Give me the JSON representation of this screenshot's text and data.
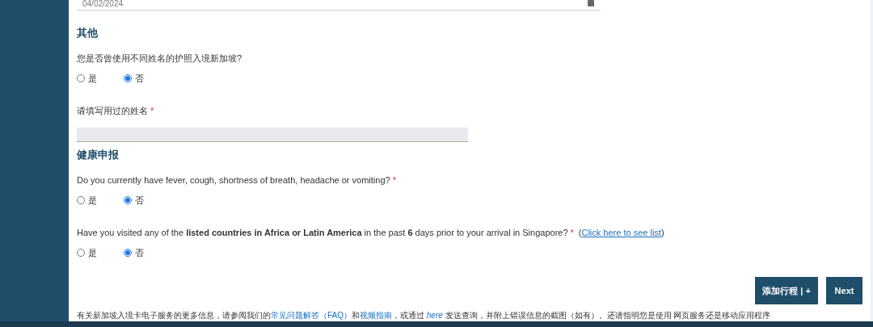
{
  "date_field": {
    "value": "04/02/2024"
  },
  "sections": [
    {
      "title": "其他",
      "questions": [
        {
          "kind": "radio",
          "text": "您是否曾使用不同姓名的护照入境新加坡?",
          "options": [
            {
              "label": "是",
              "selected": false
            },
            {
              "label": "否",
              "selected": true
            }
          ]
        },
        {
          "kind": "text",
          "text": "请填写用过的姓名",
          "required_mark": "*"
        }
      ]
    },
    {
      "title": "健康申报",
      "questions": [
        {
          "kind": "radio",
          "text": "Do you currently have fever, cough, shortness of breath, headache or vomiting?",
          "required_mark": "*",
          "options": [
            {
              "label": "是",
              "selected": false
            },
            {
              "label": "否",
              "selected": true
            }
          ]
        },
        {
          "kind": "radio",
          "text": "Have you visited any of the **listed countries in Africa or Latin America** in the past **6** days prior to your arrival in Singapore?",
          "required_mark": "*",
          "link": {
            "open": "(",
            "text": "Click here to see list",
            "close": ")"
          },
          "options": [
            {
              "label": "是",
              "selected": false
            },
            {
              "label": "否",
              "selected": true
            }
          ]
        }
      ]
    }
  ],
  "buttons": [
    "添加行程 | +",
    "Next"
  ],
  "footer": [
    {
      "kind": "text",
      "text": "有关新加坡入境卡电子服务的更多信息，请参阅我们的"
    },
    {
      "kind": "link",
      "text": "常见问题解答（FAQ）"
    },
    {
      "kind": "text",
      "text": "和"
    },
    {
      "kind": "link",
      "text": "视频指南"
    },
    {
      "kind": "text",
      "text": "，或通过 "
    },
    {
      "kind": "italic-link",
      "text": "here"
    },
    {
      "kind": "text",
      "text": " 发送查询，并附上错误信息的截图（如有）。还请指明您是使用 网页服务还是移动应用程序"
    }
  ]
}
